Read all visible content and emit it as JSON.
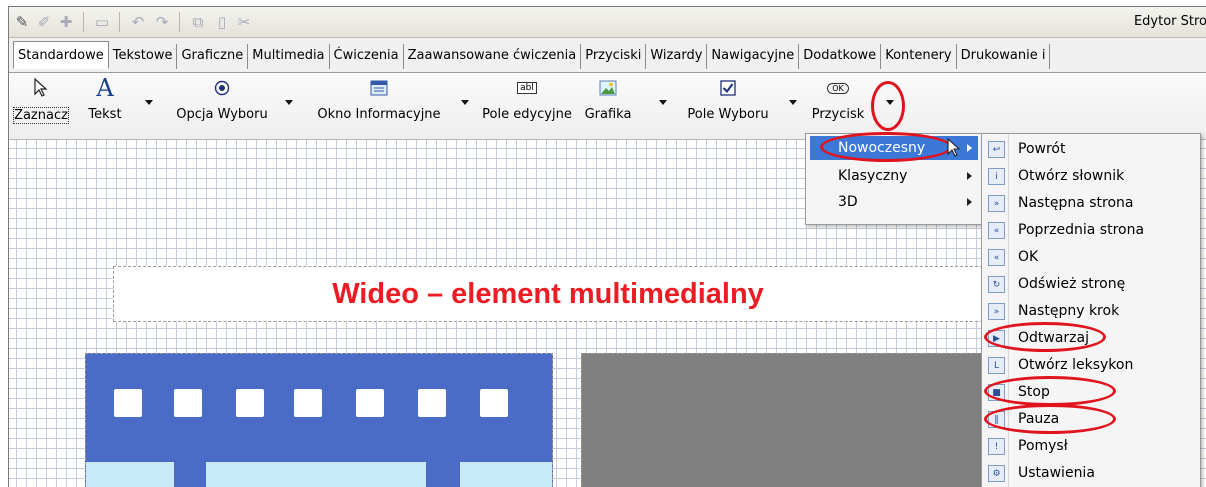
{
  "app": {
    "title": "Edytor Stro"
  },
  "quickbar": {
    "icons": [
      "edit-icon",
      "pencil-icon",
      "add-icon",
      "page-icon",
      "undo-icon",
      "redo-icon",
      "copy-icon",
      "paste-icon",
      "cut-icon"
    ]
  },
  "tabs": [
    {
      "label": "Standardowe",
      "active": true
    },
    {
      "label": "Tekstowe"
    },
    {
      "label": "Graficzne"
    },
    {
      "label": "Multimedia"
    },
    {
      "label": "Ćwiczenia"
    },
    {
      "label": "Zaawansowane ćwiczenia"
    },
    {
      "label": "Przyciski"
    },
    {
      "label": "Wizardy"
    },
    {
      "label": "Nawigacyjne"
    },
    {
      "label": "Dodatkowe"
    },
    {
      "label": "Kontenery"
    },
    {
      "label": "Drukowanie i"
    }
  ],
  "ribbon": {
    "select": {
      "label": "Zaznacz",
      "icon": "cursor-icon"
    },
    "text": {
      "label": "Tekst",
      "icon": "text-a-icon"
    },
    "option": {
      "label": "Opcja Wyboru",
      "icon": "radio-icon"
    },
    "infobox": {
      "label": "Okno Informacyjne",
      "icon": "window-icon"
    },
    "editfield": {
      "label": "Pole edycyjne",
      "icon": "textfield-icon",
      "glyph": "abl"
    },
    "graphic": {
      "label": "Grafika",
      "icon": "image-icon"
    },
    "checkbox": {
      "label": "Pole Wyboru",
      "icon": "checkbox-icon"
    },
    "button": {
      "label": "Przycisk",
      "icon": "button-icon",
      "glyph": "OK"
    }
  },
  "canvas": {
    "title": "Wideo – element multimedialny"
  },
  "menu_style": {
    "items": [
      {
        "label": "Nowoczesny",
        "highlighted": true
      },
      {
        "label": "Klasyczny"
      },
      {
        "label": "3D"
      }
    ]
  },
  "menu_buttons": {
    "items": [
      {
        "label": "Powrót",
        "glyph": "↩"
      },
      {
        "label": "Otwórz słownik",
        "glyph": "i"
      },
      {
        "label": "Następna strona",
        "glyph": "»"
      },
      {
        "label": "Poprzednia strona",
        "glyph": "«"
      },
      {
        "label": "OK",
        "glyph": "«"
      },
      {
        "label": "Odśwież stronę",
        "glyph": "↻"
      },
      {
        "label": "Następny krok",
        "glyph": "»"
      },
      {
        "label": "Odtwarzaj",
        "glyph": "▶"
      },
      {
        "label": "Otwórz leksykon",
        "glyph": "L"
      },
      {
        "label": "Stop",
        "glyph": "■"
      },
      {
        "label": "Pauza",
        "glyph": "‖"
      },
      {
        "label": "Pomysł",
        "glyph": "!"
      },
      {
        "label": "Ustawienia",
        "glyph": "⚙"
      }
    ]
  },
  "colors": {
    "annotation_red": "#e0141e",
    "title_red": "#ed1c24",
    "menu_highlight": "#3b78d8",
    "video_blue": "#4b6cc6"
  }
}
